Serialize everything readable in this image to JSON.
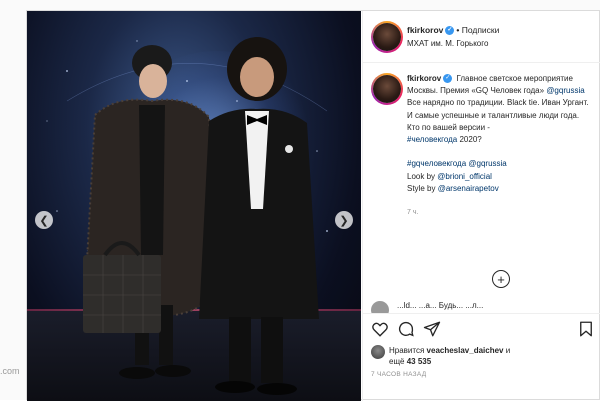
{
  "watermark": ".com",
  "header": {
    "username": "fkirkorov",
    "follow_label": "Подписки",
    "location": "МХАТ им. М. Горького"
  },
  "caption": {
    "username": "fkirkorov",
    "line1": "Главное светское мероприятие Москвы. Премия «GQ Человек года»",
    "mention1": "@gqrussia",
    "line2": "Все нарядно по традиции. Black tie. Иван Ургант. И самые успешные и талантливые люди года.",
    "line3": "Кто по вашей версии -",
    "hashtag1": "#человекгода",
    "line3_end": "2020?",
    "hashtag2": "#gqчеловекгода",
    "mention2": "@gqrussia",
    "look_label": "Look by",
    "look_link": "@brioni_official",
    "style_label": "Style by",
    "style_link": "@arsenairapetov",
    "time": "7 ч."
  },
  "comment_peek": {
    "text": "...ld... ...a...  Будь... ...л..."
  },
  "likes": {
    "prefix": "Нравится",
    "user": "veacheslav_daichev",
    "suffix": "и",
    "more_prefix": "ещё",
    "count": "43 535"
  },
  "time_ago": "7 ЧАСОВ НАЗАД",
  "icons": {
    "prev": "chevron-left-icon",
    "next": "chevron-right-icon",
    "like": "heart-icon",
    "comment": "comment-icon",
    "share": "send-icon",
    "save": "bookmark-icon",
    "load_more": "plus-circle-icon"
  },
  "colors": {
    "link": "#00376b",
    "verified": "#3897f0",
    "border": "#dbdbdb"
  }
}
